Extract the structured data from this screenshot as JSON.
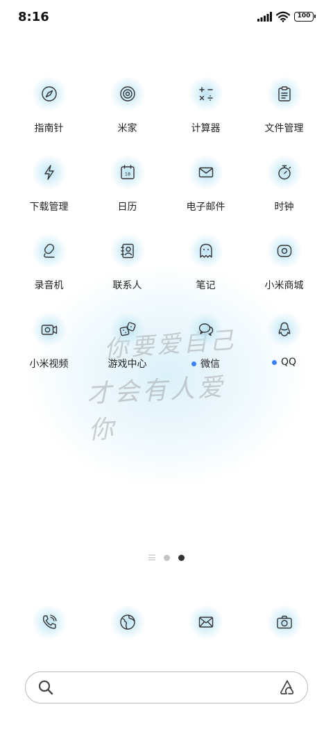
{
  "status_bar": {
    "time": "8:16",
    "battery": "100"
  },
  "apps": [
    [
      {
        "label": "指南针",
        "icon": "compass-icon"
      },
      {
        "label": "米家",
        "icon": "target-icon"
      },
      {
        "label": "计算器",
        "icon": "calculator-icon"
      },
      {
        "label": "文件管理",
        "icon": "clipboard-icon"
      }
    ],
    [
      {
        "label": "下载管理",
        "icon": "lightning-icon"
      },
      {
        "label": "日历",
        "icon": "calendar-icon",
        "calendar_day": "18"
      },
      {
        "label": "电子邮件",
        "icon": "envelope-icon"
      },
      {
        "label": "时钟",
        "icon": "stopwatch-icon"
      }
    ],
    [
      {
        "label": "录音机",
        "icon": "recorder-icon"
      },
      {
        "label": "联系人",
        "icon": "contacts-icon"
      },
      {
        "label": "笔记",
        "icon": "ghost-icon"
      },
      {
        "label": "小米商城",
        "icon": "shop-icon"
      }
    ],
    [
      {
        "label": "小米视频",
        "icon": "video-camera-icon"
      },
      {
        "label": "游戏中心",
        "icon": "dice-icon"
      },
      {
        "label": "微信",
        "icon": "chat-bubbles-icon",
        "notification": true
      },
      {
        "label": "QQ",
        "icon": "penguin-icon",
        "notification": true
      }
    ]
  ],
  "dock": [
    {
      "icon": "phone-icon"
    },
    {
      "icon": "globe-icon"
    },
    {
      "icon": "message-icon"
    },
    {
      "icon": "camera-icon"
    }
  ],
  "search": {
    "placeholder": ""
  },
  "colors": {
    "notification_dot": "#3a82f7",
    "icon_glow": "#aadcf2",
    "icon_stroke": "#333333"
  }
}
